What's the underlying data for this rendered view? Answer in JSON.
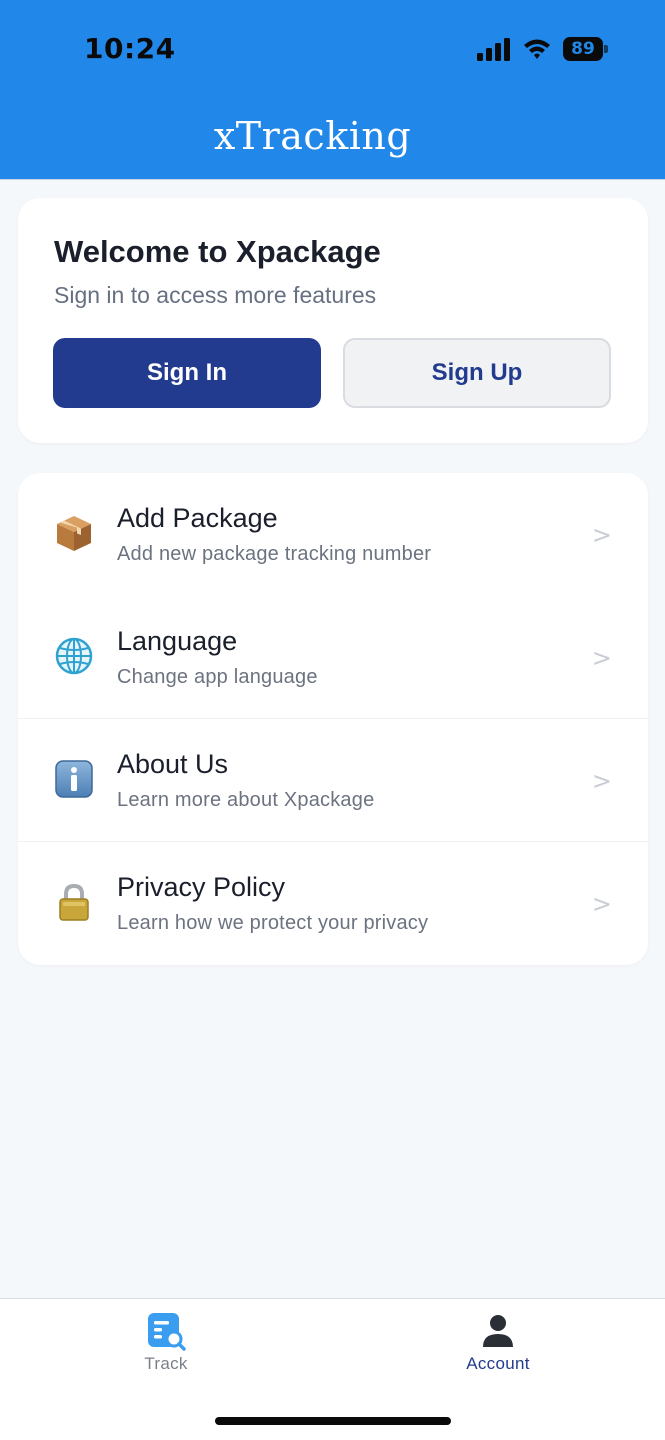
{
  "status_bar": {
    "time": "10:24",
    "battery": "89",
    "icons": [
      "signal-icon",
      "wifi-icon",
      "battery-icon"
    ]
  },
  "header": {
    "title": "xTracking",
    "background_color": "#2187e8"
  },
  "welcome": {
    "title": "Welcome to Xpackage",
    "subtitle": "Sign in to access more features",
    "sign_in_label": "Sign In",
    "sign_up_label": "Sign Up",
    "primary_color": "#233b8e"
  },
  "menu": {
    "items": [
      {
        "title": "Add Package",
        "subtitle": "Add new package tracking number",
        "icon": "package-icon",
        "chevron": ">"
      },
      {
        "title": "Language",
        "subtitle": "Change app language",
        "icon": "globe-icon",
        "chevron": ">"
      },
      {
        "title": "About Us",
        "subtitle": "Learn more about Xpackage",
        "icon": "info-icon",
        "chevron": ">"
      },
      {
        "title": "Privacy Policy",
        "subtitle": "Learn how we protect your privacy",
        "icon": "lock-icon",
        "chevron": ">"
      }
    ]
  },
  "tabbar": {
    "tabs": [
      {
        "label": "Track",
        "icon": "track-icon",
        "active": false
      },
      {
        "label": "Account",
        "icon": "account-icon",
        "active": true
      }
    ]
  }
}
